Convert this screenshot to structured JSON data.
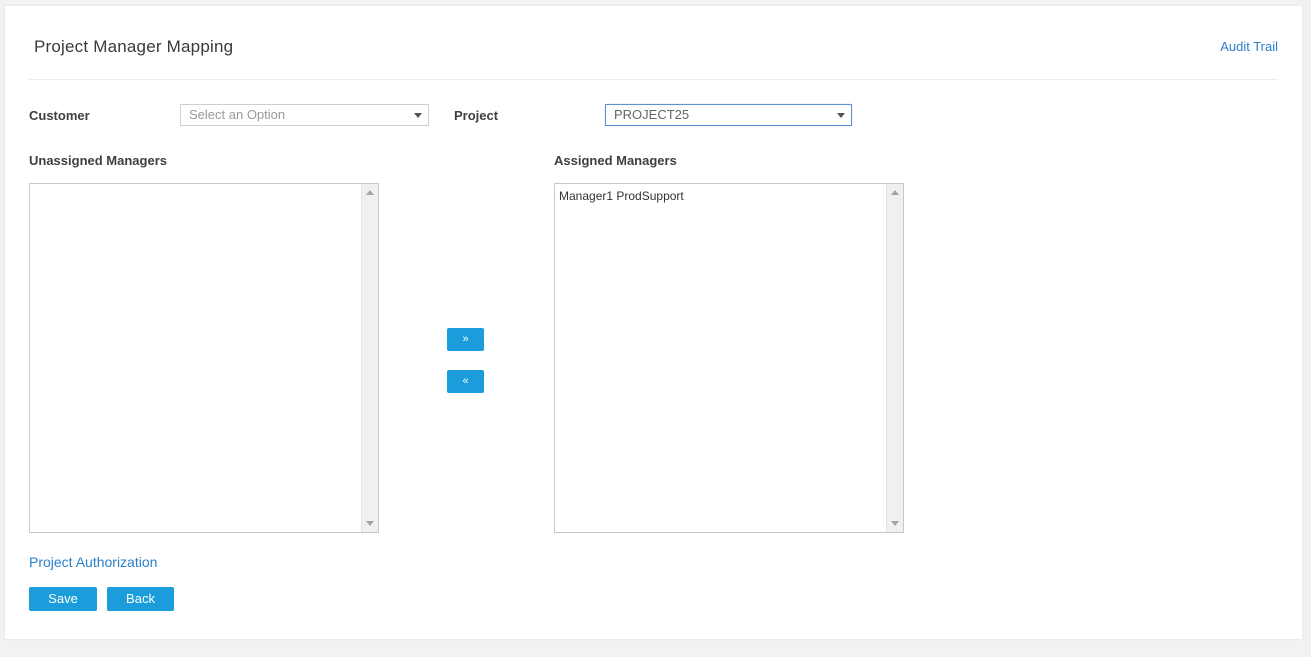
{
  "header": {
    "title": "Project Manager Mapping",
    "audit_trail_link": "Audit Trail"
  },
  "filters": {
    "customer": {
      "label": "Customer",
      "placeholder": "Select an Option",
      "value": ""
    },
    "project": {
      "label": "Project",
      "value": "PROJECT25"
    }
  },
  "unassigned": {
    "label": "Unassigned Managers",
    "items": []
  },
  "assigned": {
    "label": "Assigned Managers",
    "items": [
      "Manager1 ProdSupport"
    ]
  },
  "transfer": {
    "move_right_label": "»",
    "move_left_label": "«"
  },
  "footer": {
    "project_authorization_link": "Project Authorization",
    "save_label": "Save",
    "back_label": "Back"
  },
  "colors": {
    "accent": "#1b9ddb",
    "link": "#2b7fc9"
  }
}
